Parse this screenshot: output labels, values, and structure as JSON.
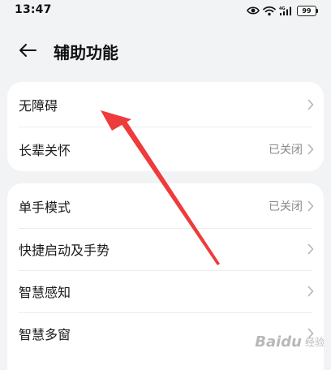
{
  "status_bar": {
    "time": "13:47",
    "battery": "99",
    "icons": [
      "eye-icon",
      "wifi-icon",
      "signal-4g-icon",
      "battery-icon"
    ]
  },
  "header": {
    "back_icon": "arrow-left-icon",
    "title": "辅助功能"
  },
  "groups": [
    {
      "items": [
        {
          "label": "无障碍",
          "value": ""
        },
        {
          "label": "长辈关怀",
          "value": "已关闭"
        }
      ]
    },
    {
      "items": [
        {
          "label": "单手模式",
          "value": "已关闭"
        },
        {
          "label": "快捷启动及手势",
          "value": ""
        },
        {
          "label": "智慧感知",
          "value": ""
        },
        {
          "label": "智慧多窗",
          "value": ""
        }
      ]
    }
  ],
  "annotation": {
    "arrow_color": "#ee3b3b"
  },
  "watermark": {
    "text": "Baidu",
    "sub": "经验"
  }
}
